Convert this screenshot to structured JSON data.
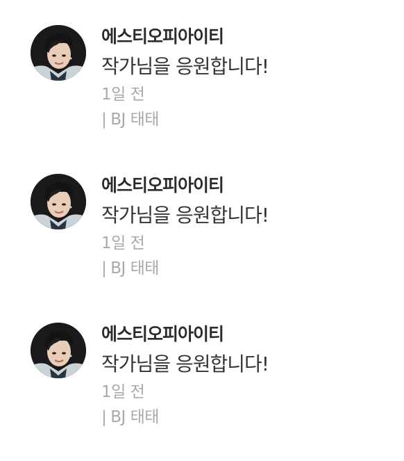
{
  "colors": {
    "username": "#2b2b2b",
    "message": "#333333",
    "meta": "#a9a9a9",
    "background": "#ffffff"
  },
  "comments": [
    {
      "avatar_icon": "profile-photo",
      "username": "에스티오피아이티",
      "message": "작가님을 응원합니다!",
      "time": "1일 전",
      "divider": "|",
      "source": "BJ 태태"
    },
    {
      "avatar_icon": "profile-photo",
      "username": "에스티오피아이티",
      "message": "작가님을 응원합니다!",
      "time": "1일 전",
      "divider": "|",
      "source": "BJ 태태"
    },
    {
      "avatar_icon": "profile-photo",
      "username": "에스티오피아이티",
      "message": "작가님을 응원합니다!",
      "time": "1일 전",
      "divider": "|",
      "source": "BJ 태태"
    }
  ]
}
